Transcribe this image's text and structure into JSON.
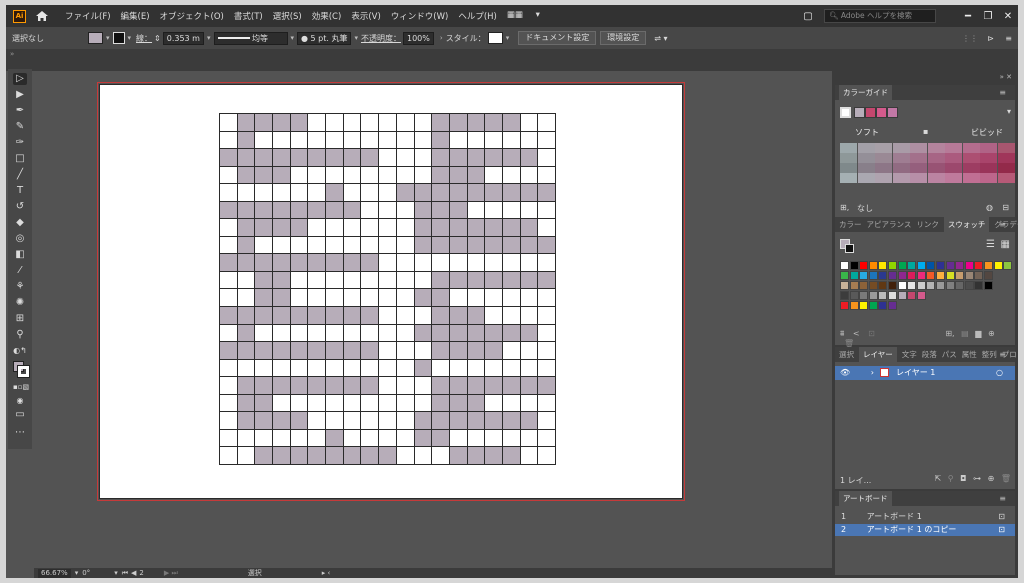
{
  "app": {
    "logo": "Ai"
  },
  "menu": [
    "ファイル(F)",
    "編集(E)",
    "オブジェクト(O)",
    "書式(T)",
    "選択(S)",
    "効果(C)",
    "表示(V)",
    "ウィンドウ(W)",
    "ヘルプ(H)"
  ],
  "search": {
    "placeholder": "Adobe ヘルプを検索"
  },
  "control": {
    "selection": "選択なし",
    "stroke_label": "線：",
    "stroke_weight": "0.353 m",
    "stroke_style": "均等",
    "brush": "5 pt. 丸筆",
    "opacity_label": "不透明度：",
    "opacity": "100%",
    "style_label": "スタイル：",
    "doc_settings": "ドキュメント設定",
    "prefs": "環境設定"
  },
  "status": {
    "zoom": "66.67%",
    "rotation": "0°",
    "artboard": "2",
    "mode": "選択"
  },
  "color_guide": {
    "title": "カラーガイド",
    "soft": "ソフト",
    "vivid": "ビビッド",
    "none_label": "なし",
    "harmony": [
      "#ffffff",
      "#b7adb9",
      "#c4476e",
      "#d45a8c",
      "#c278a6"
    ],
    "variations": [
      [
        "#9da8ab",
        "#a3a0a8",
        "#a8a0a8",
        "#a99ba7",
        "#ae8fa2",
        "#b4849d",
        "#b77a98",
        "#b46d8e",
        "#b06386",
        "#a8566f"
      ],
      [
        "#8e9899",
        "#948f98",
        "#9a8995",
        "#9f7d92",
        "#a3708b",
        "#a76585",
        "#ab5a7e",
        "#ac4f72",
        "#a9446b",
        "#a0365a"
      ],
      [
        "#7f898b",
        "#887f8a",
        "#8d7687",
        "#916b82",
        "#955f7d",
        "#985374",
        "#9c486d",
        "#9d3d62",
        "#9a345a",
        "#932a4a"
      ],
      [
        "#a5b0b3",
        "#aaa8b1",
        "#afa3af",
        "#b39aac",
        "#b78fa8",
        "#bb84a2",
        "#bf7a9c",
        "#c06f93",
        "#bd668b",
        "#b65a77"
      ]
    ]
  },
  "swatches": {
    "tabs": [
      "カラー",
      "アピアランス",
      "リンク",
      "スウォッチ",
      "グラデーション"
    ],
    "active_tab": "スウォッチ",
    "rows": [
      [
        "#ffffff",
        "#000000",
        "#ff0000",
        "#ff8a00",
        "#ffe600",
        "#8fd400",
        "#00a651",
        "#00a99d",
        "#00aeef",
        "#0054a6",
        "#2e3192",
        "#662d91",
        "#92278f",
        "#ec008c",
        "#ed1c24",
        "#f7941d",
        "#fff200",
        "#8dc63f"
      ],
      [
        "#39b54a",
        "#00a99d",
        "#27aae1",
        "#1c75bc",
        "#2b3990",
        "#662d91",
        "#8e278f",
        "#d91c5c",
        "#ee2a7b",
        "#f15a29",
        "#fbb040",
        "#d7df23",
        "#c69c6d",
        "#998675",
        "#736357",
        "#534741"
      ],
      [
        "#c7b299",
        "#a67c52",
        "#8c6239",
        "#754c24",
        "#603813",
        "#42210b",
        "#ffffff",
        "#e6e6e6",
        "#cccccc",
        "#b3b3b3",
        "#999999",
        "#808080",
        "#666666",
        "#4d4d4d",
        "#333333",
        "#000000"
      ],
      [
        "#3c3c3c",
        "#595959",
        "#7a7a7a",
        "#9b9b9b",
        "#bcbcbc",
        "#dddddd",
        "#b7adb9",
        "#c4476e",
        "#d45a8c"
      ],
      [
        "#ed1c24",
        "#f7941d",
        "#fff200",
        "#00a651",
        "#2e3192",
        "#662d91"
      ]
    ]
  },
  "layers": {
    "tabs": [
      "選択",
      "レイヤー",
      "文字",
      "段落",
      "パス",
      "属性",
      "整列",
      "プロ"
    ],
    "active_tab": "レイヤー",
    "items": [
      {
        "name": "レイヤー 1"
      }
    ],
    "count_label": "1 レイ..."
  },
  "artboards": {
    "title": "アートボード",
    "items": [
      {
        "num": "1",
        "name": "アートボード 1"
      },
      {
        "num": "2",
        "name": "アートボード 1 のコピー"
      }
    ]
  },
  "grid_pattern": [
    "0111100000001111100",
    "0100000000001000000",
    "1111111110001111110",
    "0111000000001110000",
    "0000001000111111111",
    "1111111100011100000",
    "0111100000011111110",
    "0100000000011111111",
    "1111111110000000000",
    "0011000000001111111",
    "0011000000011000000",
    "1111111110001110000",
    "0100000000011111110",
    "1111111110001111000",
    "0000000000010000000",
    "0111111110001111111",
    "0110000000001110000",
    "0111100000011111110",
    "0000001000011000000",
    "0011111111000111100"
  ]
}
